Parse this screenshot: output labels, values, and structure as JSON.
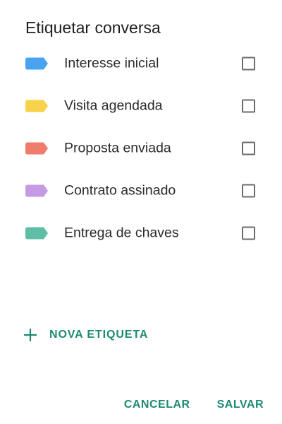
{
  "dialog": {
    "title": "Etiquetar conversa"
  },
  "labels": [
    {
      "text": "Interesse inicial",
      "color": "#4aa3f0",
      "checked": false
    },
    {
      "text": "Visita agendada",
      "color": "#f7d24a",
      "checked": false
    },
    {
      "text": "Proposta enviada",
      "color": "#f07c6c",
      "checked": false
    },
    {
      "text": "Contrato assinado",
      "color": "#c79ae6",
      "checked": false
    },
    {
      "text": "Entrega de chaves",
      "color": "#5fbea5",
      "checked": false
    }
  ],
  "new_label": {
    "icon": "plus-icon",
    "text": "NOVA ETIQUETA"
  },
  "actions": {
    "cancel_label": "CANCELAR",
    "save_label": "SALVAR"
  },
  "colors": {
    "accent": "#1d8a74"
  }
}
